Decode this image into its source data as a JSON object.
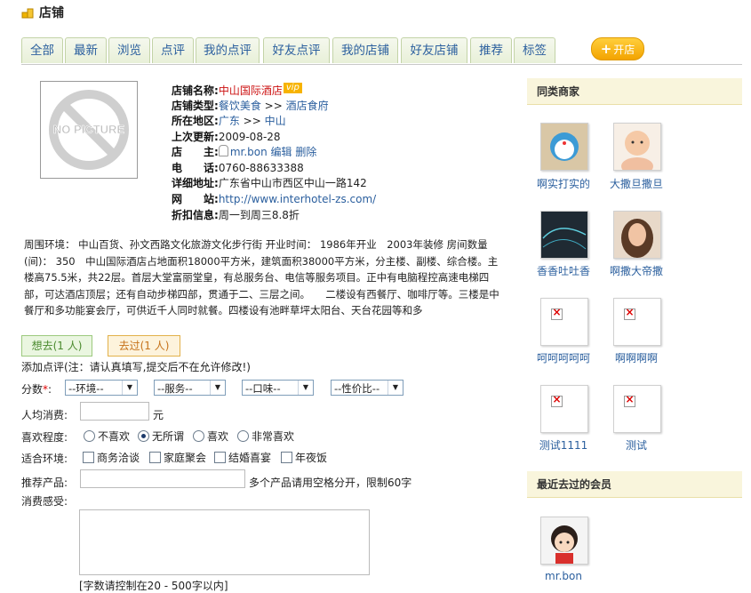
{
  "header": {
    "title": "店铺"
  },
  "tabs": [
    "全部",
    "最新",
    "浏览",
    "点评",
    "我的点评",
    "好友点评",
    "我的店铺",
    "好友店铺",
    "推荐",
    "标签"
  ],
  "open_shop": "开店",
  "shop": {
    "image_alt": "NO PICTURE",
    "fields": [
      {
        "key": "店铺名称:",
        "value": "中山国际酒店",
        "badge": "vip"
      },
      {
        "key": "店铺类型:",
        "value": "餐饮美食",
        "sep": ">>",
        "value2": "酒店食府"
      },
      {
        "key": "所在地区:",
        "value": "广东",
        "sep": ">>",
        "value2": "中山"
      },
      {
        "key": "上次更新:",
        "value": "2009-08-28"
      },
      {
        "key": "店　　主:",
        "value": "mr.bon",
        "edit": "编辑",
        "delete": "删除"
      },
      {
        "key": "电　　话:",
        "value": "0760-88633388"
      },
      {
        "key": "详细地址:",
        "value": "广东省中山市西区中山一路142"
      },
      {
        "key": "网　　站:",
        "value": "http://www.interhotel-zs.com/"
      },
      {
        "key": "折扣信息:",
        "value": "周一到周三8.8折"
      }
    ],
    "description": "周围环境： 中山百货、孙文西路文化旅游文化步行街 开业时间： 1986年开业　2003年装修 房间数量(间)： 350　中山国际酒店占地面积18000平方米，建筑面积38000平方米，分主楼、副楼、综合楼。主楼高75.5米，共22层。首层大堂富丽堂皇，有总服务台、电信等服务项目。正中有电脑程控高速电梯四部，可达酒店顶层；还有自动步梯四部，贯通于二、三层之间。　　二楼设有西餐厅、咖啡厅等。三楼是中餐厅和多功能宴会厅，可供近千人同时就餐。四楼设有池畔草坪太阳台、天台花园等和多"
  },
  "want_button": "想去(1 人)",
  "went_button": "去过(1 人)",
  "review": {
    "note": "添加点评(注：请认真填写,提交后不在允许修改!)",
    "score_label": "分数",
    "required_mark": "*",
    "score_selects": [
      "--环境--",
      "--服务--",
      "--口味--",
      "--性价比--"
    ],
    "avg_label": "人均消费:",
    "avg_unit": "元",
    "like_label": "喜欢程度:",
    "like_options": [
      "不喜欢",
      "无所谓",
      "喜欢",
      "非常喜欢"
    ],
    "like_selected_index": 1,
    "env_label": "适合环境:",
    "env_options": [
      "商务洽谈",
      "家庭聚会",
      "结婚喜宴",
      "年夜饭"
    ],
    "recommend_label": "推荐产品:",
    "recommend_hint": "多个产品请用空格分开，限制60字",
    "feeling_label": "消费感受:",
    "char_limit": "[字数请控制在20 - 500字以内]"
  },
  "sidebar": {
    "similar_title": "同类商家",
    "similar": [
      "啊实打实的",
      "大撒旦撒旦",
      "香香吐吐香",
      "啊撒大帝撒",
      "呵呵呵呵呵",
      "啊啊啊啊",
      "测试1111",
      "测试"
    ],
    "recent_title": "最近去过的会员",
    "recent": [
      "mr.bon"
    ]
  },
  "colors": {
    "link": "#2b5f9e",
    "accent": "#f7b300",
    "shop_name": "#cc1111"
  }
}
